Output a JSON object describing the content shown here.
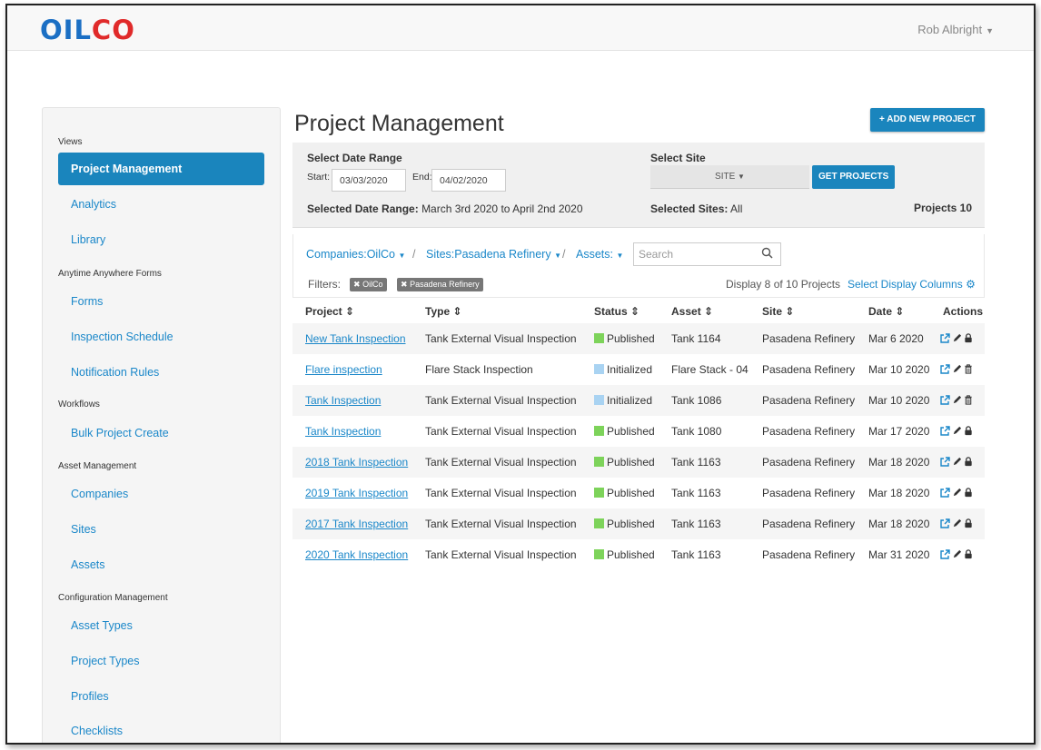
{
  "app": {
    "logo_part1": "OIL",
    "logo_part2": "CO",
    "user_name": "Rob Albright"
  },
  "sidebar": {
    "sections": [
      {
        "title": "Views",
        "items": [
          "Project Management",
          "Analytics",
          "Library"
        ]
      },
      {
        "title": "Anytime Anywhere Forms",
        "items": [
          "Forms",
          "Inspection Schedule",
          "Notification Rules"
        ]
      },
      {
        "title": "Workflows",
        "items": [
          "Bulk Project Create"
        ]
      },
      {
        "title": "Asset Management",
        "items": [
          "Companies",
          "Sites",
          "Assets"
        ]
      },
      {
        "title": "Configuration Management",
        "items": [
          "Asset Types",
          "Project Types",
          "Profiles",
          "Checklists"
        ]
      }
    ],
    "active": "Project Management"
  },
  "page": {
    "title": "Project Management",
    "add_button": "+ ADD NEW PROJECT"
  },
  "filters": {
    "date_range_label": "Select Date Range",
    "start_label": "Start:",
    "start_value": "03/03/2020",
    "end_label": "End:",
    "end_value": "04/02/2020",
    "site_label": "Select Site",
    "site_select": "SITE",
    "get_button": "GET PROJECTS",
    "selected_range_label": "Selected Date Range:",
    "selected_range_value": "March 3rd 2020 to April 2nd 2020",
    "selected_sites_label": "Selected Sites:",
    "selected_sites_value": "All",
    "projects_label": "Projects",
    "projects_count": "10"
  },
  "toolbar": {
    "companies": "Companies:OilCo",
    "sites": "Sites:Pasadena Refinery",
    "assets": "Assets:",
    "search_placeholder": "Search",
    "filters_label": "Filters:",
    "chips": [
      "OilCo",
      "Pasadena Refinery"
    ],
    "display_text": "Display 8 of 10 Projects",
    "select_columns": "Select Display Columns"
  },
  "table": {
    "headers": [
      "Project",
      "Type",
      "Status",
      "Asset",
      "Site",
      "Date",
      "Actions"
    ],
    "rows": [
      {
        "project": "New Tank Inspection",
        "type": "Tank External Visual Inspection",
        "status": "Published",
        "asset": "Tank 1164",
        "site": "Pasadena Refinery",
        "date": "Mar 6 2020",
        "last_action": "lock"
      },
      {
        "project": "Flare inspection",
        "type": "Flare Stack Inspection",
        "status": "Initialized",
        "asset": "Flare Stack - 04",
        "site": "Pasadena Refinery",
        "date": "Mar 10 2020",
        "last_action": "trash"
      },
      {
        "project": "Tank Inspection",
        "type": "Tank External Visual Inspection",
        "status": "Initialized",
        "asset": "Tank 1086",
        "site": "Pasadena Refinery",
        "date": "Mar 10 2020",
        "last_action": "trash"
      },
      {
        "project": "Tank Inspection",
        "type": "Tank External Visual Inspection",
        "status": "Published",
        "asset": "Tank 1080",
        "site": "Pasadena Refinery",
        "date": "Mar 17 2020",
        "last_action": "lock"
      },
      {
        "project": "2018 Tank Inspection",
        "type": "Tank External Visual Inspection",
        "status": "Published",
        "asset": "Tank 1163",
        "site": "Pasadena Refinery",
        "date": "Mar 18 2020",
        "last_action": "lock"
      },
      {
        "project": "2019 Tank Inspection",
        "type": "Tank External Visual Inspection",
        "status": "Published",
        "asset": "Tank 1163",
        "site": "Pasadena Refinery",
        "date": "Mar 18 2020",
        "last_action": "lock"
      },
      {
        "project": "2017 Tank Inspection",
        "type": "Tank External Visual Inspection",
        "status": "Published",
        "asset": "Tank 1163",
        "site": "Pasadena Refinery",
        "date": "Mar 18 2020",
        "last_action": "lock"
      },
      {
        "project": "2020 Tank Inspection",
        "type": "Tank External Visual Inspection",
        "status": "Published",
        "asset": "Tank 1163",
        "site": "Pasadena Refinery",
        "date": "Mar 31 2020",
        "last_action": "lock"
      }
    ]
  },
  "colors": {
    "accent": "#1a85bd",
    "link": "#1a87c9",
    "published": "#7dd35a",
    "initialized": "#a9d3f2"
  },
  "icons": {
    "external": "external-link-icon",
    "edit": "pencil-icon",
    "lock": "lock-icon",
    "trash": "trash-icon",
    "search": "search-icon",
    "gear": "gear-icon",
    "sort": "sort-icon",
    "chip_close": "close-icon"
  }
}
